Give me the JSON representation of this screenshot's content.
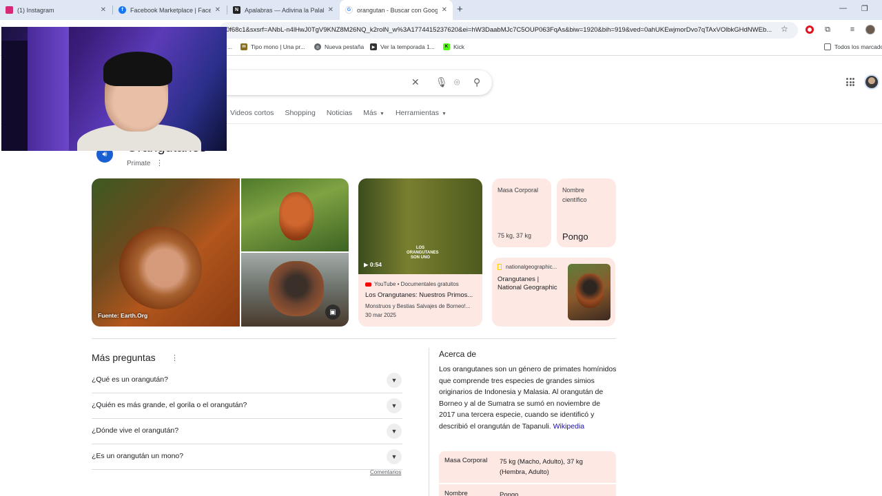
{
  "browser": {
    "tabs": [
      {
        "label": "(1) Instagram",
        "icon": "instagram-icon",
        "color": "#d62976",
        "active": false
      },
      {
        "label": "Facebook Marketplace | Facebook",
        "icon": "facebook-icon",
        "color": "#1877f2",
        "active": false
      },
      {
        "label": "Apalabras — Adivina la Palabra",
        "icon": "apalabras-icon",
        "color": "#222222",
        "active": false
      },
      {
        "label": "orangutan - Buscar con Google",
        "icon": "google-icon",
        "color": "#4285f4",
        "active": true
      }
    ],
    "tab_close": "✕",
    "new_tab": "+",
    "url": "0f68c1&sxsrf=ANbL-n4lHwJ0TgV9KNZ8M26NQ_k2rolN_w%3A1774415237620&ei=hW3DaabMJc7C5OUP063FqAs&biw=1920&bih=919&ved=0ahUKEwjmorDvo7qTAxVOlbkGHdNWEb...",
    "bookmarks": [
      {
        "label": "Tipo mono | Una pr...",
        "color": "#8a6d1f",
        "glyph": "m"
      },
      {
        "label": "Nueva pestaña",
        "color": "#5f6368",
        "glyph": "◎"
      },
      {
        "label": "Ver la temporada 1...",
        "color": "#333333",
        "glyph": "▶"
      },
      {
        "label": "Kick",
        "color": "#53fc18",
        "glyph": "K"
      }
    ],
    "bookmark_prefix": "...",
    "all_bookmarks": "Todos los marcadores"
  },
  "search": {
    "nav_tabs": [
      "Videos cortos",
      "Shopping",
      "Noticias",
      "Más",
      "Herramientas"
    ]
  },
  "knowledge_panel": {
    "title": "Orangutanes",
    "subtitle": "Primate",
    "image_caption": "Fuente: Earth.Org",
    "video": {
      "duration": "0:54",
      "thumb_text": "LOS ORANGUTANES SON UNO",
      "source": "YouTube • Documentales gratuitos",
      "title": "Los Orangutanes: Nuestros Primos...",
      "channel": "Monstruos y Bestias Salvajes de Borneo!...",
      "date": "30 mar 2025"
    },
    "facts": [
      {
        "label": "Masa Corporal",
        "value": "75 kg, 37 kg"
      },
      {
        "label": "Nombre científico",
        "value": "Pongo"
      }
    ],
    "natgeo": {
      "source": "nationalgeographic...",
      "title": "Orangutanes | National Geographic"
    }
  },
  "paa": {
    "title": "Más preguntas",
    "questions": [
      "¿Qué es un orangután?",
      "¿Quién es más grande, el gorila o el orangután?",
      "¿Dónde vive el orangután?",
      "¿Es un orangután un mono?"
    ],
    "comments": "Comentarios"
  },
  "about": {
    "title": "Acerca de",
    "text": "Los orangutanes son un género de primates homínidos que comprende tres especies de grandes simios originarios de Indonesia y Malasia. Al orangután de Borneo y al de Sumatra se sumó en noviembre de 2017 una tercera especie, cuando se identificó y describió el orangután de Tapanuli.",
    "link": "Wikipedia",
    "table": [
      {
        "key": "Masa Corporal",
        "value": "75 kg (Macho, Adulto), 37 kg (Hembra, Adulto)"
      },
      {
        "key": "Nombre",
        "value": "Pongo"
      }
    ]
  },
  "colors": {
    "card_bg": "#fde8e3",
    "link": "#1a0dab",
    "accent_blue": "#1a5fd1"
  }
}
